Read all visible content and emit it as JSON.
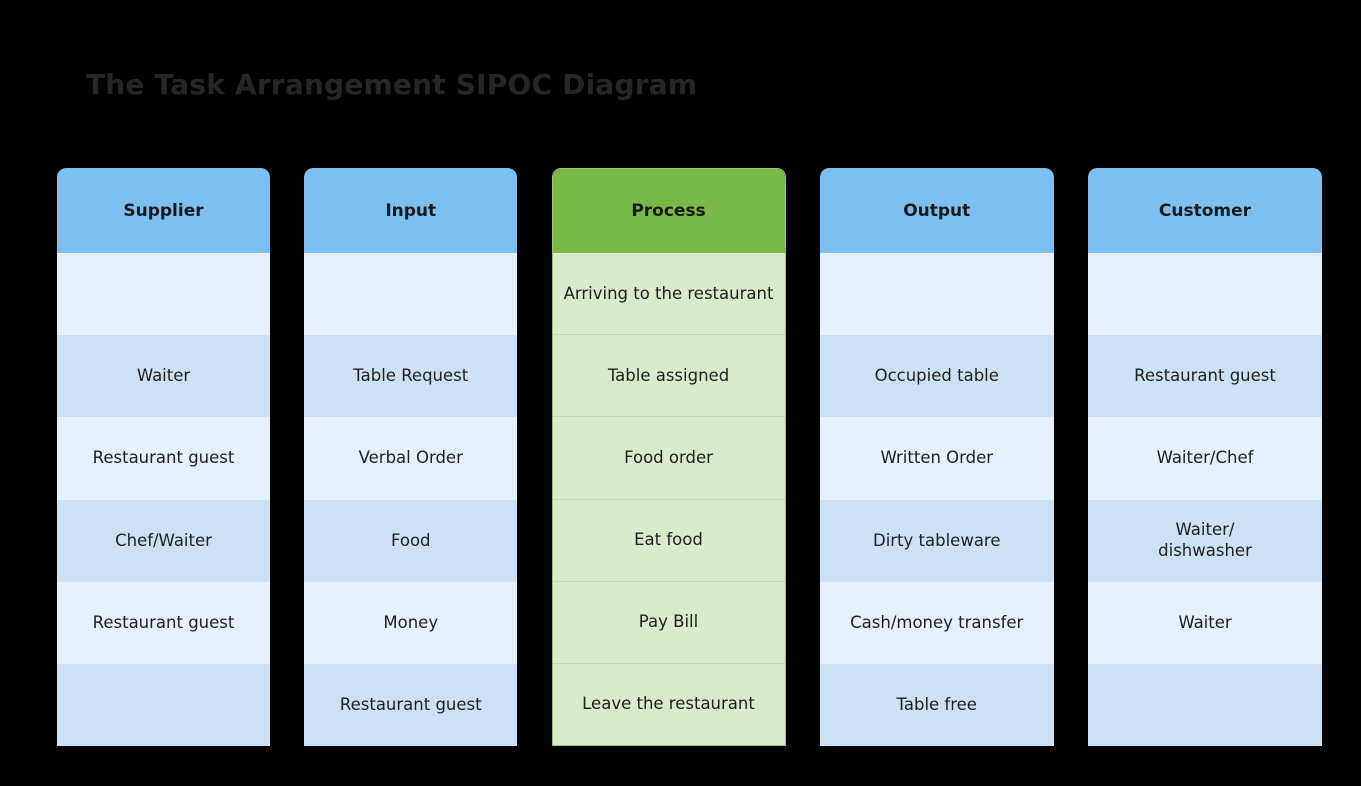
{
  "title": "The Task Arrangement SIPOC Diagram",
  "colors": {
    "background": "#000000",
    "title_text": "#262626",
    "header_blue": "#7BC0F0",
    "header_green": "#78B948",
    "row_blue_light": "#E6F0FA",
    "row_blue_dark": "#CCE1F5",
    "row_green": "#DAEBC9",
    "cell_text": "#1F1F1F"
  },
  "columns": [
    {
      "key": "supplier",
      "header": "Supplier",
      "accent": "blue",
      "cells": [
        "",
        "Waiter",
        "Restaurant guest",
        "Chef/Waiter",
        "Restaurant guest",
        ""
      ]
    },
    {
      "key": "input",
      "header": "Input",
      "accent": "blue",
      "cells": [
        "",
        "Table Request",
        "Verbal Order",
        "Food",
        "Money",
        "Restaurant guest"
      ]
    },
    {
      "key": "process",
      "header": "Process",
      "accent": "green",
      "cells": [
        "Arriving to the restaurant",
        "Table assigned",
        "Food order",
        "Eat food",
        "Pay Bill",
        "Leave the restaurant"
      ]
    },
    {
      "key": "output",
      "header": "Output",
      "accent": "blue",
      "cells": [
        "",
        "Occupied table",
        "Written Order",
        "Dirty tableware",
        "Cash/money transfer",
        "Table free"
      ]
    },
    {
      "key": "customer",
      "header": "Customer",
      "accent": "blue",
      "cells": [
        "",
        "Restaurant guest",
        "Waiter/Chef",
        "Waiter/\ndishwasher",
        "Waiter",
        ""
      ]
    }
  ]
}
